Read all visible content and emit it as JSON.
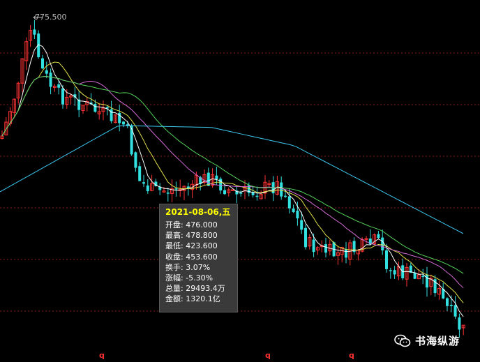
{
  "colors": {
    "background": "#000000",
    "up": "#ff3333",
    "down": "#33e0e0",
    "grid": "#8b1a1a",
    "ma5": "#ffffff",
    "ma10": "#e0e04a",
    "ma20": "#d36ad6",
    "ma30": "#55d25a",
    "ma60": "#3cc8f0",
    "tooltip_date": "#ffff00"
  },
  "high_marker": {
    "label": "775.500"
  },
  "tooltip": {
    "date": "2021-08-06,五",
    "rows": [
      {
        "label": "开盘",
        "value": "476.000"
      },
      {
        "label": "最高",
        "value": "478.800"
      },
      {
        "label": "最低",
        "value": "423.600"
      },
      {
        "label": "收盘",
        "value": "453.600"
      },
      {
        "label": "换手",
        "value": "3.07%"
      },
      {
        "label": "涨幅",
        "value": "-5.30%"
      },
      {
        "label": "总量",
        "value": "29493.4万"
      },
      {
        "label": "金额",
        "value": "1320.1亿"
      }
    ]
  },
  "bottom_marks": [
    "q",
    "q",
    "q"
  ],
  "watermark": {
    "icon": "wechat-icon",
    "text": "书海纵游"
  }
}
